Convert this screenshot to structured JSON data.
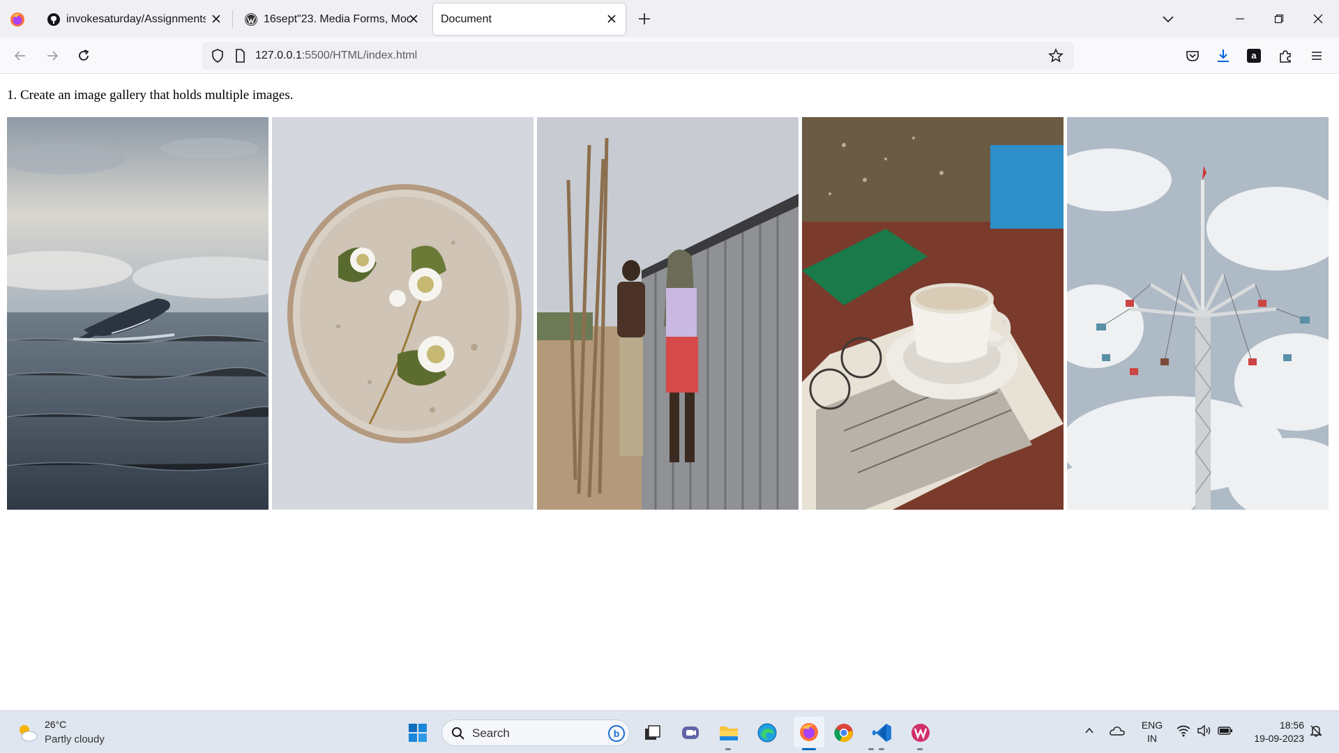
{
  "browser": {
    "tabs": [
      {
        "label": "invokesaturday/Assignments",
        "favicon": "github-icon"
      },
      {
        "label": "16sept\"23. Media Forms, Modern",
        "favicon": "wordpress-icon"
      },
      {
        "label": "Document",
        "favicon": "",
        "active": true
      }
    ],
    "url": {
      "host": "127.0.0.1",
      "path": ":5500/HTML/index.html"
    },
    "icons": [
      "back-icon",
      "forward-icon",
      "reload-icon",
      "shield-icon",
      "page-icon",
      "bookmark-star-icon",
      "pocket-icon",
      "download-icon",
      "amazon-icon",
      "extensions-icon",
      "menu-icon"
    ]
  },
  "page": {
    "heading": "1. Create an image gallery that holds multiple images.",
    "gallery": [
      {
        "name": "whale-photo",
        "subject": "humpback whale breaching in the ocean"
      },
      {
        "name": "flower-plate-photo",
        "subject": "white flowers on a ceramic plate"
      },
      {
        "name": "two-men-photo",
        "subject": "two men standing by a corrugated metal shed"
      },
      {
        "name": "coffee-cup-photo",
        "subject": "coffee cup with glasses and newspaper"
      },
      {
        "name": "swing-ride-photo",
        "subject": "chain swing carousel tower against sky"
      }
    ]
  },
  "taskbar": {
    "weather": {
      "temp": "26°C",
      "desc": "Partly cloudy"
    },
    "search_label": "Search",
    "apps": [
      "windows-start-icon",
      "search-icon",
      "bing-icon",
      "task-view-icon",
      "chat-icon",
      "file-explorer-icon",
      "edge-icon",
      "firefox-icon",
      "chrome-icon",
      "vscode-icon",
      "wps-office-icon"
    ],
    "tray": {
      "lang_line1": "ENG",
      "lang_line2": "IN",
      "time": "18:56",
      "date": "19-09-2023"
    },
    "colors": {
      "accent": "#0067c0",
      "taskbar_bg": "#dfe6ef"
    }
  }
}
